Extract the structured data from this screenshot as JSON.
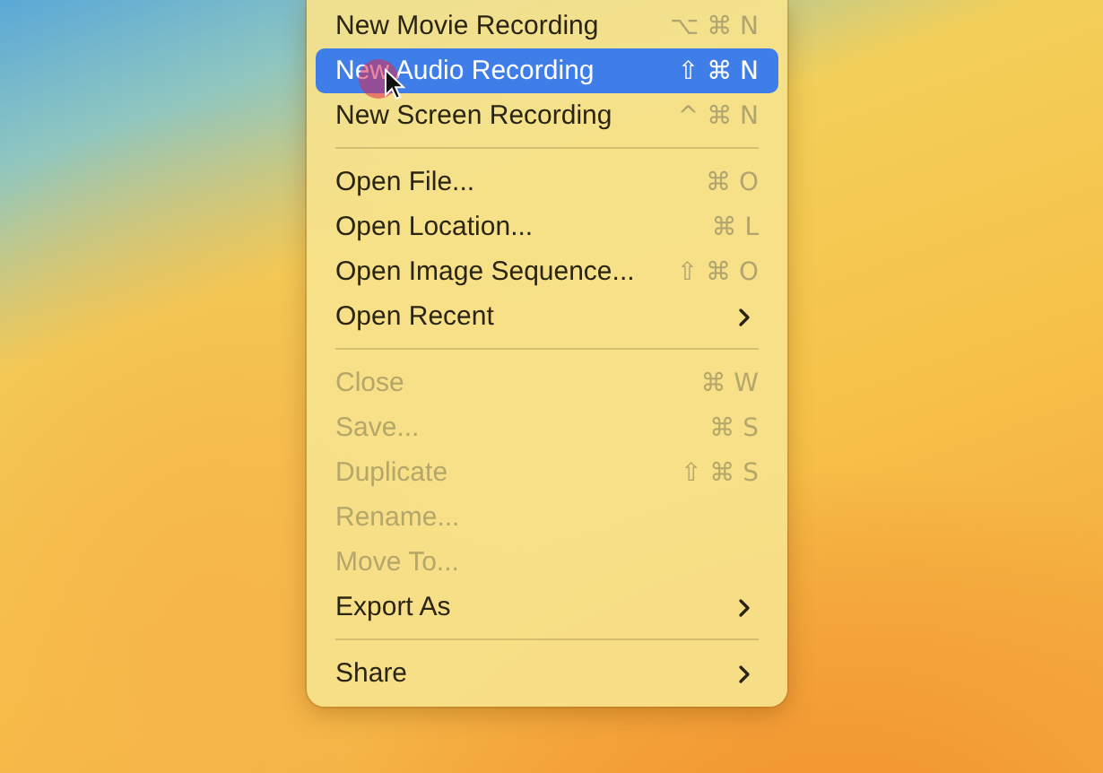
{
  "menu": {
    "groups": [
      [
        {
          "label": "New Movie Recording",
          "kind": "shortcut",
          "shortcut": "⌥ ⌘ N",
          "disabled": false,
          "selected": false
        },
        {
          "label": "New Audio Recording",
          "kind": "shortcut",
          "shortcut": "⇧ ⌘ N",
          "disabled": false,
          "selected": true
        },
        {
          "label": "New Screen Recording",
          "kind": "shortcut",
          "shortcut": "^ ⌘ N",
          "disabled": false,
          "selected": false
        }
      ],
      [
        {
          "label": "Open File...",
          "kind": "shortcut",
          "shortcut": "⌘ O",
          "disabled": false,
          "selected": false
        },
        {
          "label": "Open Location...",
          "kind": "shortcut",
          "shortcut": "⌘ L",
          "disabled": false,
          "selected": false
        },
        {
          "label": "Open Image Sequence...",
          "kind": "shortcut",
          "shortcut": "⇧ ⌘ O",
          "disabled": false,
          "selected": false
        },
        {
          "label": "Open Recent",
          "kind": "submenu",
          "disabled": false,
          "selected": false
        }
      ],
      [
        {
          "label": "Close",
          "kind": "shortcut",
          "shortcut": "⌘ W",
          "disabled": true,
          "selected": false
        },
        {
          "label": "Save...",
          "kind": "shortcut",
          "shortcut": "⌘ S",
          "disabled": true,
          "selected": false
        },
        {
          "label": "Duplicate",
          "kind": "shortcut",
          "shortcut": "⇧ ⌘ S",
          "disabled": true,
          "selected": false
        },
        {
          "label": "Rename...",
          "kind": "plain",
          "disabled": true,
          "selected": false
        },
        {
          "label": "Move To...",
          "kind": "plain",
          "disabled": true,
          "selected": false
        },
        {
          "label": "Export As",
          "kind": "submenu",
          "disabled": false,
          "selected": false
        }
      ],
      [
        {
          "label": "Share",
          "kind": "submenu",
          "disabled": false,
          "selected": false
        }
      ]
    ]
  }
}
